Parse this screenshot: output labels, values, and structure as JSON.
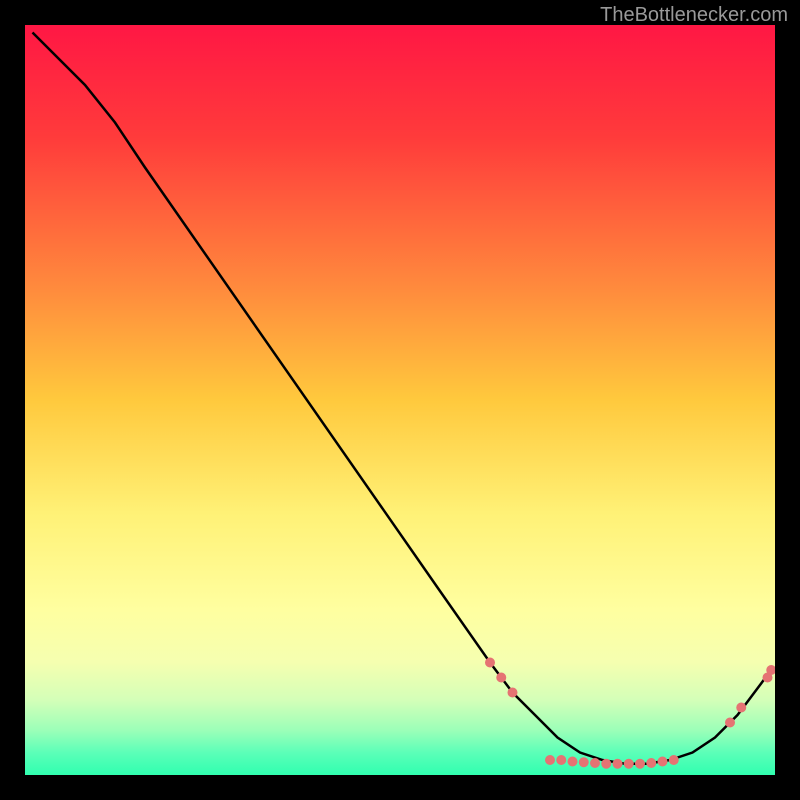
{
  "watermark": "TheBottlenecker.com",
  "chart_data": {
    "type": "line",
    "title": "",
    "xlabel": "",
    "ylabel": "",
    "xlim": [
      0,
      100
    ],
    "ylim": [
      0,
      100
    ],
    "gradient_stops": [
      {
        "offset": 0,
        "color": "#ff1744"
      },
      {
        "offset": 15,
        "color": "#ff3b3b"
      },
      {
        "offset": 35,
        "color": "#ff8a3d"
      },
      {
        "offset": 50,
        "color": "#ffc93d"
      },
      {
        "offset": 65,
        "color": "#fff176"
      },
      {
        "offset": 78,
        "color": "#ffffa0"
      },
      {
        "offset": 85,
        "color": "#f5ffb0"
      },
      {
        "offset": 90,
        "color": "#d4ffb8"
      },
      {
        "offset": 94,
        "color": "#9cffb8"
      },
      {
        "offset": 97,
        "color": "#5cffb8"
      },
      {
        "offset": 100,
        "color": "#30ffb0"
      }
    ],
    "curve_points": [
      {
        "x": 1,
        "y": 99
      },
      {
        "x": 4,
        "y": 96
      },
      {
        "x": 8,
        "y": 92
      },
      {
        "x": 12,
        "y": 87
      },
      {
        "x": 16,
        "y": 81
      },
      {
        "x": 55,
        "y": 25
      },
      {
        "x": 62,
        "y": 15
      },
      {
        "x": 65,
        "y": 11
      },
      {
        "x": 68,
        "y": 8
      },
      {
        "x": 71,
        "y": 5
      },
      {
        "x": 74,
        "y": 3
      },
      {
        "x": 77,
        "y": 2
      },
      {
        "x": 80,
        "y": 1.5
      },
      {
        "x": 83,
        "y": 1.5
      },
      {
        "x": 86,
        "y": 2
      },
      {
        "x": 89,
        "y": 3
      },
      {
        "x": 92,
        "y": 5
      },
      {
        "x": 95,
        "y": 8
      },
      {
        "x": 98,
        "y": 12
      },
      {
        "x": 99.5,
        "y": 14
      }
    ],
    "scatter_points": [
      {
        "x": 62,
        "y": 15
      },
      {
        "x": 63.5,
        "y": 13
      },
      {
        "x": 65,
        "y": 11
      },
      {
        "x": 70,
        "y": 2
      },
      {
        "x": 71.5,
        "y": 2
      },
      {
        "x": 73,
        "y": 1.8
      },
      {
        "x": 74.5,
        "y": 1.7
      },
      {
        "x": 76,
        "y": 1.6
      },
      {
        "x": 77.5,
        "y": 1.5
      },
      {
        "x": 79,
        "y": 1.5
      },
      {
        "x": 80.5,
        "y": 1.5
      },
      {
        "x": 82,
        "y": 1.5
      },
      {
        "x": 83.5,
        "y": 1.6
      },
      {
        "x": 85,
        "y": 1.8
      },
      {
        "x": 86.5,
        "y": 2
      },
      {
        "x": 94,
        "y": 7
      },
      {
        "x": 95.5,
        "y": 9
      },
      {
        "x": 99,
        "y": 13
      },
      {
        "x": 99.5,
        "y": 14
      }
    ],
    "scatter_color": "#e57373",
    "scatter_radius": 5
  }
}
